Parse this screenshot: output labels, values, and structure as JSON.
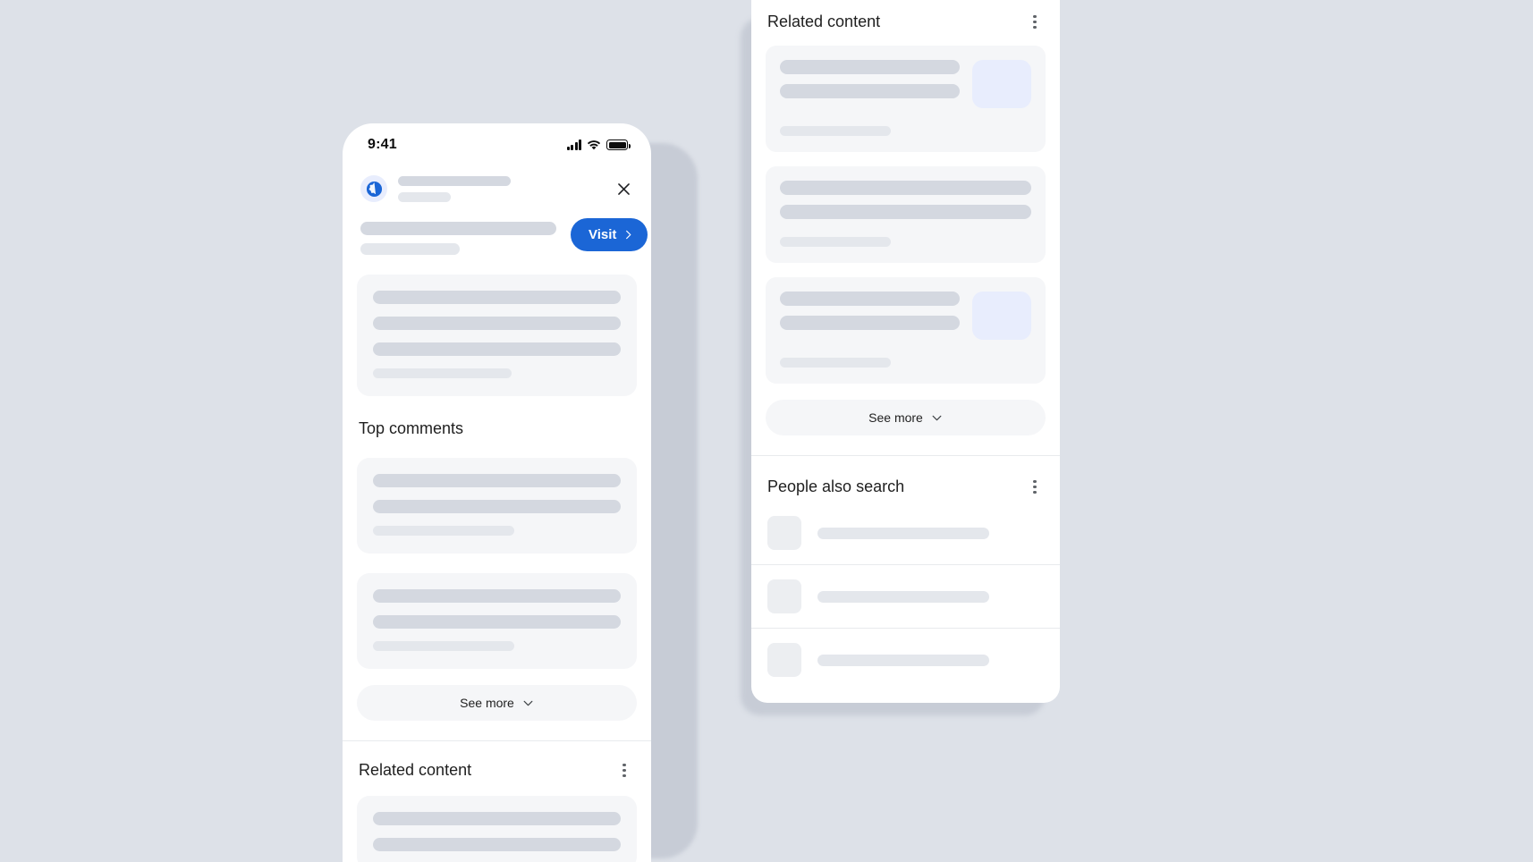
{
  "theme": {
    "page_background": "#dde1e8",
    "surface": "#ffffff",
    "card_background": "#f5f6f8",
    "skeleton_dark": "#d4d8e0",
    "skeleton_light": "#e4e7ec",
    "thumbnail_blue": "#e8edfd",
    "accent_blue": "#1b66d6",
    "text_primary": "#1f1f1f",
    "divider": "#e8eaed"
  },
  "phone": {
    "status_bar": {
      "clock": "9:41",
      "signal_icon": "cellular-signal-icon",
      "wifi_icon": "wifi-icon",
      "battery_icon": "battery-full-icon"
    },
    "header": {
      "site_icon": "globe-icon",
      "close_icon": "close-icon"
    },
    "visit_button": {
      "label": "Visit",
      "chevron_icon": "chevron-right-icon"
    },
    "sections": {
      "top_comments_title": "Top comments",
      "related_content_title": "Related content",
      "see_more_label": "See more",
      "see_more_chevron_icon": "chevron-down-icon",
      "overflow_icon": "more-vertical-icon"
    }
  },
  "panel": {
    "related_content": {
      "title": "Related content",
      "overflow_icon": "more-vertical-icon",
      "see_more_label": "See more",
      "see_more_chevron_icon": "chevron-down-icon",
      "cards": [
        {
          "has_thumbnail": true,
          "lines": 2,
          "footer_line": true
        },
        {
          "has_thumbnail": false,
          "lines": 2,
          "footer_line": true
        },
        {
          "has_thumbnail": true,
          "lines": 2,
          "footer_line": true
        }
      ]
    },
    "people_also_search": {
      "title": "People also search",
      "overflow_icon": "more-vertical-icon",
      "rows": [
        {
          "thumbnail_icon": "result-thumbnail-icon"
        },
        {
          "thumbnail_icon": "result-thumbnail-icon"
        },
        {
          "thumbnail_icon": "result-thumbnail-icon"
        }
      ]
    }
  }
}
